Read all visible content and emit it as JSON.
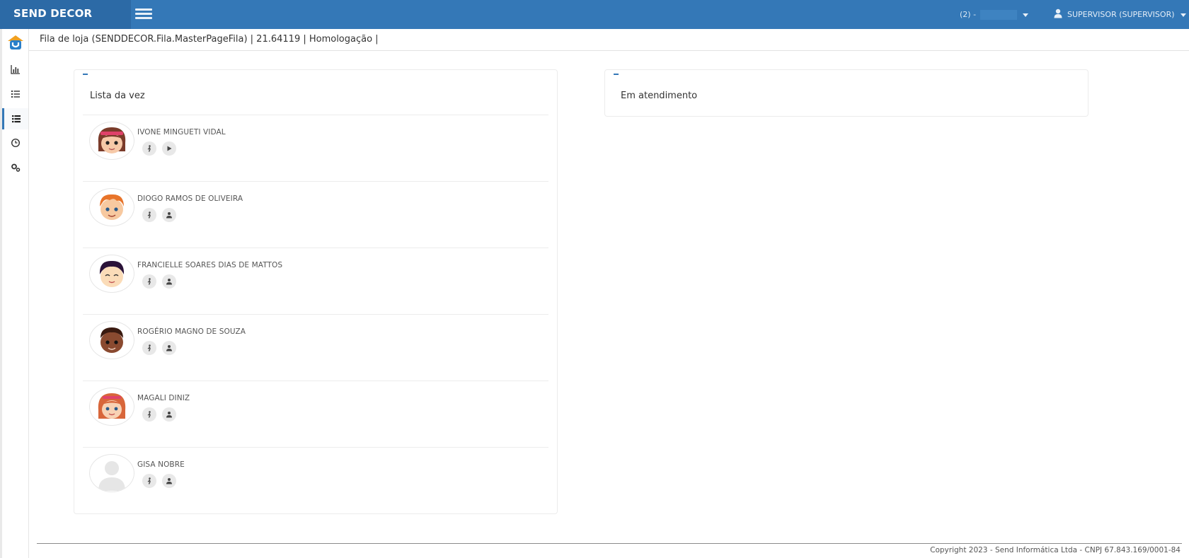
{
  "header": {
    "brand": "SEND DECOR",
    "store_label": "(2) -",
    "user_label": "SUPERVISOR (SUPERVISOR)"
  },
  "breadcrumb": "Fila de loja (SENDDECOR.Fila.MasterPageFila) | 21.64119 | Homologação |",
  "queue_panel": {
    "title": "Lista da vez",
    "items": [
      {
        "name": "IVONE MINGUETI VIDAL",
        "avatar": "girl-avatar-brown-hair",
        "second_action": "play-icon"
      },
      {
        "name": "DIOGO RAMOS DE OLIVEIRA",
        "avatar": "boy-avatar-orange-hair",
        "second_action": "user-icon"
      },
      {
        "name": "FRANCIELLE SOARES DIAS DE MATTOS",
        "avatar": "avatar-black-hair-closed-eyes",
        "second_action": "user-icon"
      },
      {
        "name": "ROGÉRIO MAGNO DE SOUZA",
        "avatar": "boy-avatar-dark-skin",
        "second_action": "user-icon"
      },
      {
        "name": "MAGALI DINIZ",
        "avatar": "girl-avatar-red-hair",
        "second_action": "user-icon"
      },
      {
        "name": "GISA NOBRE",
        "avatar": "default-avatar-silhouette",
        "second_action": "user-icon"
      }
    ]
  },
  "service_panel": {
    "title": "Em atendimento"
  },
  "footer": {
    "copyright": "Copyright 2023 - Send Informática Ltda - CNPJ 67.843.169/0001-84"
  },
  "colors": {
    "topbar": "#3478b7",
    "brand_bg": "#2c6aa6",
    "accent": "#3478b7"
  }
}
